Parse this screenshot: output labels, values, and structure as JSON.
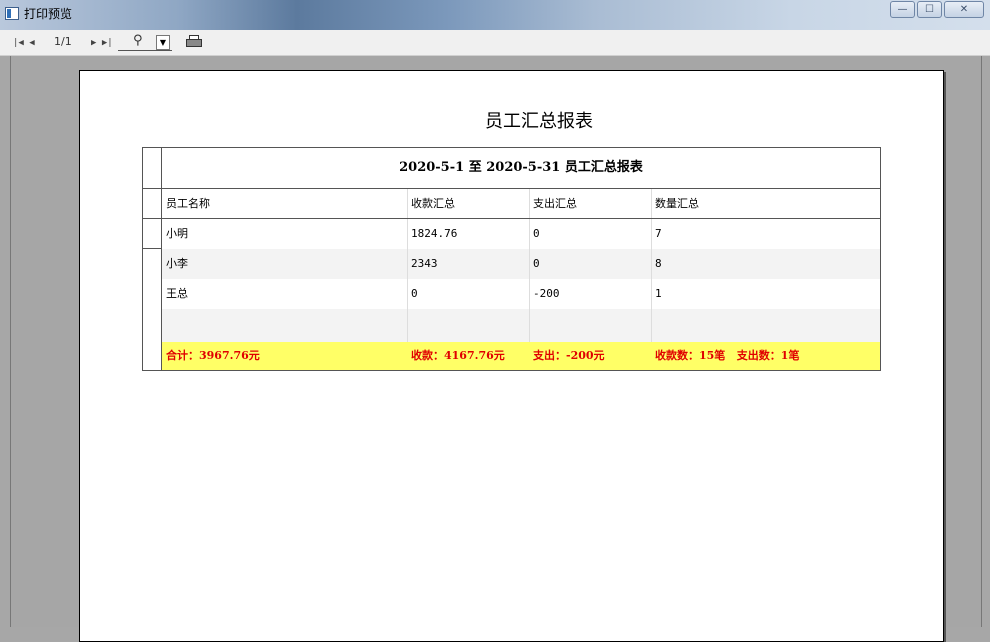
{
  "window": {
    "title": "打印预览",
    "buttons": {
      "minimize": "—",
      "maximize": "☐",
      "close": "✕"
    }
  },
  "toolbar": {
    "first_label": "|◀ ◀",
    "page_indicator": "1/1",
    "next_label": "▶ ▶|",
    "zoom_icon": "⚲",
    "dropdown_arrow": "▼"
  },
  "report": {
    "title": "员工汇总报表",
    "table_title": "2020-5-1 至 2020-5-31 员工汇总报表",
    "columns": [
      "员工名称",
      "收款汇总",
      "支出汇总",
      "数量汇总"
    ],
    "rows": [
      [
        "小明",
        "1824.76",
        "0",
        "7"
      ],
      [
        "小李",
        "2343",
        "0",
        "8"
      ],
      [
        "王总",
        "0",
        "-200",
        "1"
      ],
      [
        "",
        "",
        "",
        ""
      ]
    ],
    "totals": {
      "sum": "合计：3967.76元",
      "income": "收款：4167.76元",
      "expense": "支出：-200元",
      "counts": "收款数：15笔   支出数：1笔"
    }
  },
  "colors": {
    "total_bg": "#ffff66",
    "total_text": "#e00000"
  }
}
